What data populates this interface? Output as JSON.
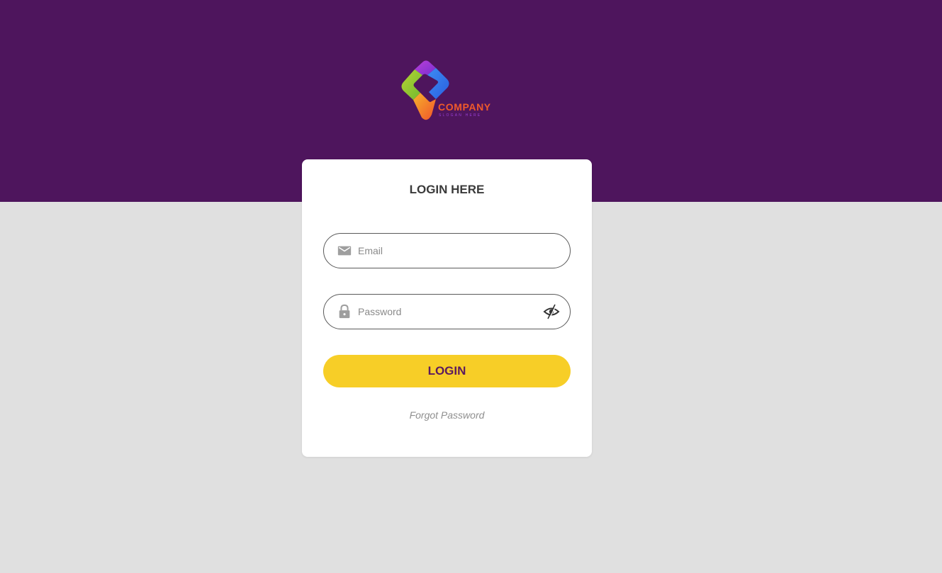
{
  "brand": {
    "name": "COMPANY",
    "slogan": "SLOGAN HERE",
    "logo_icon": "diamond-chevron-logo-icon",
    "header_color": "#4e155d",
    "background_color": "#e0e0e0"
  },
  "login_card": {
    "title": "LOGIN HERE",
    "email": {
      "value": "",
      "placeholder": "Email",
      "icon": "mail-icon"
    },
    "password": {
      "value": "",
      "placeholder": "Password",
      "icon": "lock-icon",
      "toggle_icon": "eye-slash-icon"
    },
    "login_button": {
      "label": "LOGIN",
      "color": "#f7ce27",
      "text_color": "#5b1a5f"
    },
    "forgot_password": "Forgot Password"
  }
}
